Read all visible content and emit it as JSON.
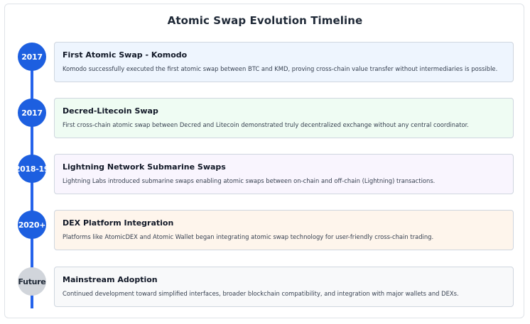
{
  "title": "Atomic Swap Evolution Timeline",
  "colors": {
    "line": "#2563eb",
    "node": "#1d5fe0",
    "node_future": "#d1d5db"
  },
  "events": [
    {
      "year": "2017",
      "title": "First Atomic Swap - Komodo",
      "description": "Komodo successfully executed the first atomic swap between BTC and KMD, proving cross-chain value transfer without intermediaries is possible.",
      "background": "#eef5fe"
    },
    {
      "year": "2017",
      "title": "Decred-Litecoin Swap",
      "description": "First cross-chain atomic swap between Decred and Litecoin demonstrated truly decentralized exchange without any central coordinator.",
      "background": "#effcf3"
    },
    {
      "year": "2018-19",
      "title": "Lightning Network Submarine Swaps",
      "description": "Lightning Labs introduced submarine swaps enabling atomic swaps between on-chain and off-chain (Lightning) transactions.",
      "background": "#f9f5fe"
    },
    {
      "year": "2020+",
      "title": "DEX Platform Integration",
      "description": "Platforms like AtomicDEX and Atomic Wallet began integrating atomic swap technology for user-friendly cross-chain trading.",
      "background": "#fef5ec"
    },
    {
      "year": "Future",
      "title": "Mainstream Adoption",
      "description": "Continued development toward simplified interfaces, broader blockchain compatibility, and integration with major wallets and DEXs.",
      "background": "#f8f9fa"
    }
  ]
}
